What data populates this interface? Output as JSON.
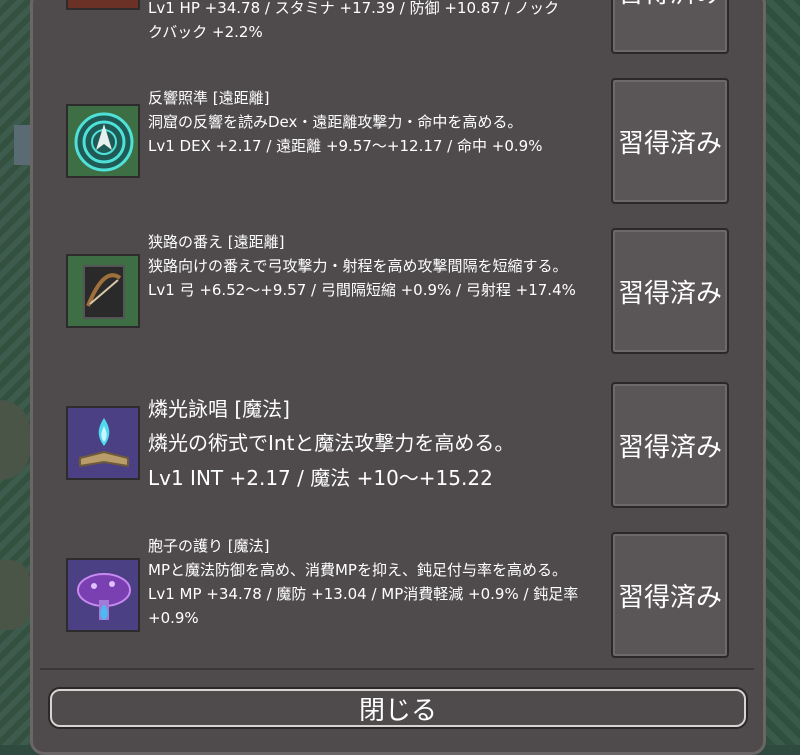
{
  "skills": [
    {
      "name": "",
      "desc": "クバック +2.2%",
      "stats": "Lv1 HP +34.78 / スタミナ +17.39 / 防御 +10.87 / ノック",
      "button": "習得済み",
      "icon": "shield-emblem-icon"
    },
    {
      "name": "反響照準 [遠距離]",
      "desc": "洞窟の反響を読みDex・遠距離攻撃力・命中を高める。",
      "stats": "Lv1 DEX +2.17 / 遠距離 +9.57～+12.17 / 命中 +0.9%",
      "button": "習得済み",
      "icon": "echo-target-icon"
    },
    {
      "name": "狭路の番え [遠距離]",
      "desc": "狭路向けの番えで弓攻撃力・射程を高め攻撃間隔を短縮する。",
      "stats": "Lv1 弓 +6.52～+9.57 / 弓間隔短縮 +0.9% / 弓射程 +17.4%",
      "button": "習得済み",
      "icon": "crossbow-icon"
    },
    {
      "name": "燐光詠唱 [魔法]",
      "desc": "燐光の術式でIntと魔法攻撃力を高める。",
      "stats": "Lv1 INT +2.17 / 魔法 +10～+15.22",
      "button": "習得済み",
      "icon": "spellbook-flame-icon"
    },
    {
      "name": "胞子の護り [魔法]",
      "desc": "MPと魔法防御を高め、消費MPを抑え、鈍足付与率を高める。",
      "stats": "Lv1 MP +34.78 / 魔防 +13.04 / MP消費軽減 +0.9% / 鈍足率 +0.9%",
      "button": "習得済み",
      "icon": "mushroom-icon"
    }
  ],
  "close_label": "閉じる",
  "colors": {
    "panel": "#4f4b4c",
    "text": "#ffffff",
    "background": "#2f4a3e"
  }
}
